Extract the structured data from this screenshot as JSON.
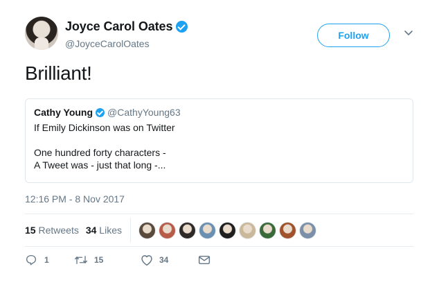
{
  "author": {
    "display_name": "Joyce Carol Oates",
    "handle": "@JoyceCarolOates",
    "avatar_icon": "user-avatar",
    "verified": true
  },
  "follow_button": {
    "label": "Follow"
  },
  "tweet": {
    "text": "Brilliant!"
  },
  "quoted_tweet": {
    "display_name": "Cathy Young",
    "handle": "@CathyYoung63",
    "verified": true,
    "line1": "If Emily Dickinson was on Twitter",
    "line2": "One hundred forty characters -",
    "line3": "A Tweet was - just that long -..."
  },
  "timestamp": "12:16 PM - 8 Nov 2017",
  "stats": {
    "retweets_count": "15",
    "retweets_label": "Retweets",
    "likes_count": "34",
    "likes_label": "Likes",
    "liker_avatars": [
      "#5a4a3c",
      "#b85c4a",
      "#2f2a28",
      "#6a8fb0",
      "#1f1f1f",
      "#c9b89a",
      "#3b6a3a",
      "#a0522d",
      "#7c8fa8"
    ]
  },
  "actions": {
    "reply_count": "1",
    "retweet_count": "15",
    "like_count": "34"
  },
  "colors": {
    "accent": "#1da1f2",
    "secondary_text": "#657786",
    "border": "#e1e8ed"
  }
}
